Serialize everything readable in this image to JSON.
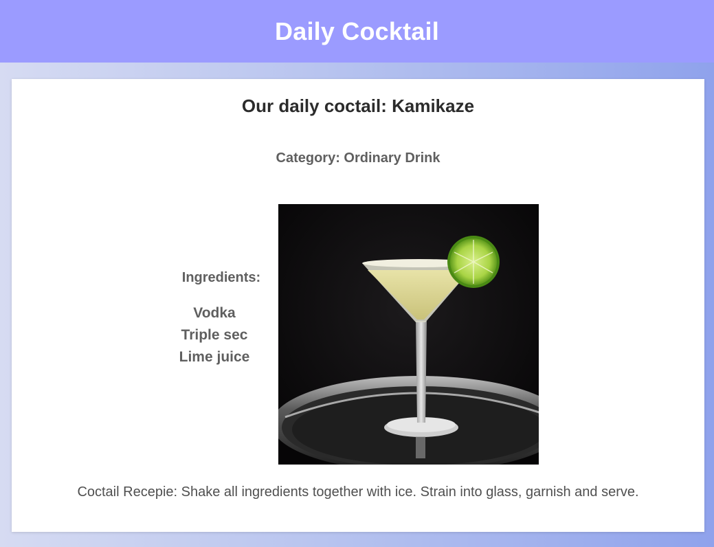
{
  "header": {
    "title": "Daily Cocktail"
  },
  "cocktail": {
    "heading": "Our daily coctail: Kamikaze",
    "category": "Category: Ordinary Drink",
    "ingredients_label": "Ingredients:",
    "ingredients": [
      "Vodka",
      "Triple sec",
      "Lime juice"
    ],
    "recipe": "Coctail Recepie: Shake all ingredients together with ice. Strain into glass, garnish and serve."
  },
  "colors": {
    "header_bg": "#9b9bff",
    "card_bg": "#ffffff",
    "text_dark": "#2b2b2b",
    "text_muted": "#5f5f5f"
  }
}
